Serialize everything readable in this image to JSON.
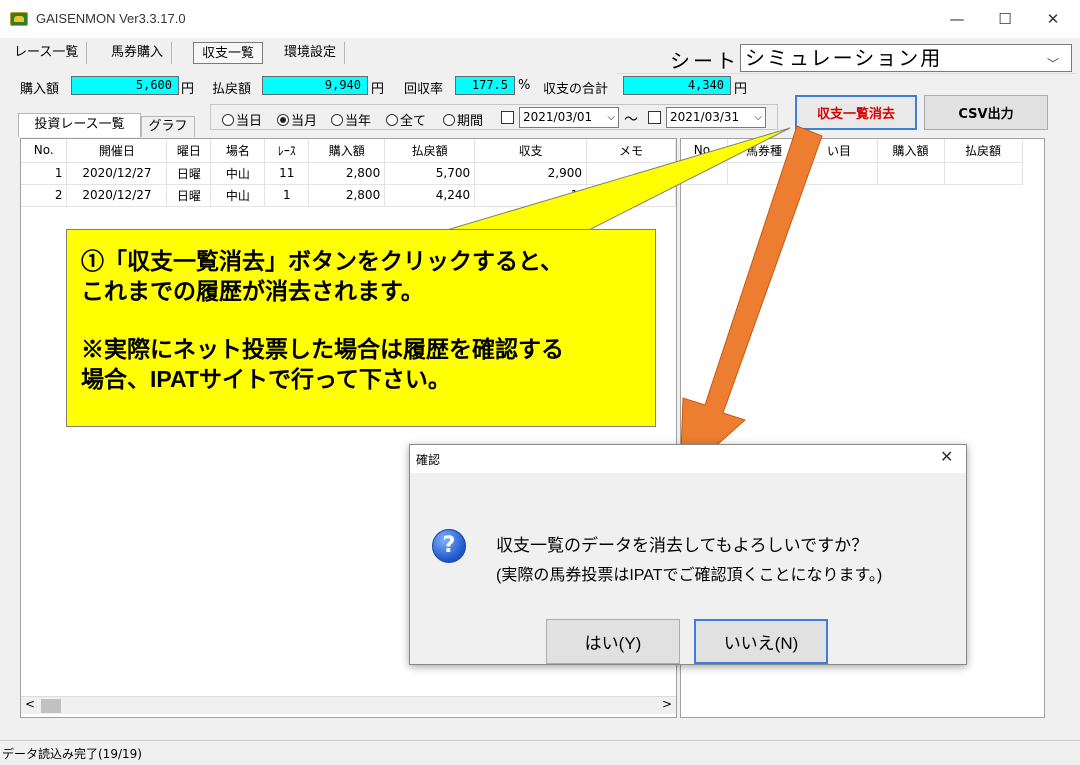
{
  "window": {
    "title": "GAISENMON Ver3.3.17.0",
    "minimize": "—",
    "maximize": "☐",
    "close": "✕"
  },
  "menu_tabs": [
    "レース一覧",
    "馬券購入",
    "収支一覧",
    "環境設定"
  ],
  "sheet": {
    "label": "シート",
    "value": "シミュレーション用",
    "arrow": "﹀"
  },
  "summary": {
    "purchase_label": "購入額",
    "purchase_value": "5,600",
    "purchase_unit": "円",
    "payout_label": "払戻額",
    "payout_value": "9,940",
    "payout_unit": "円",
    "rate_label": "回収率",
    "rate_value": "177.5",
    "rate_unit": "%",
    "total_label": "収支の合計",
    "total_value": "4,340",
    "total_unit": "円"
  },
  "sub_tabs": [
    "投資レース一覧",
    "グラフ"
  ],
  "period": {
    "options": [
      "当日",
      "当月",
      "当年",
      "全て",
      "期間"
    ],
    "selected": "当月",
    "from_date": "2021/03/01",
    "to_date": "2021/03/31",
    "tilde": "〜"
  },
  "buttons": {
    "clear": "収支一覧消去",
    "csv": "CSV出力"
  },
  "left_table": {
    "headers": [
      "No.",
      "開催日",
      "曜日",
      "場名",
      "ﾚｰｽ",
      "購入額",
      "払戻額",
      "収支",
      "メモ"
    ],
    "rows": [
      [
        "1",
        "2020/12/27",
        "日曜",
        "中山",
        "11",
        "2,800",
        "5,700",
        "2,900",
        ""
      ],
      [
        "2",
        "2020/12/27",
        "日曜",
        "中山",
        "1",
        "2,800",
        "4,240",
        "1,",
        ""
      ]
    ]
  },
  "right_table": {
    "headers": [
      "No.",
      "馬券種",
      "い目",
      "購入額",
      "払戻額"
    ]
  },
  "status": {
    "text": "データ読込み完了(19/19)"
  },
  "callout": {
    "line1": "①「収支一覧消去」ボタンをクリックすると、",
    "line2": "これまでの履歴が消去されます。",
    "line3": "※実際にネット投票した場合は履歴を確認する",
    "line4": "場合、IPATサイトで行って下さい。",
    "fill_color": "#ffff00",
    "arrow_color": "#ed7d31"
  },
  "dialog": {
    "title": "確認",
    "close": "✕",
    "icon": "?",
    "message1": "収支一覧のデータを消去してもよろしいですか？",
    "message2": "(実際の馬券投票はIPATでご確認頂くことになります。)",
    "yes": "はい(Y)",
    "no": "いいえ(N)"
  }
}
